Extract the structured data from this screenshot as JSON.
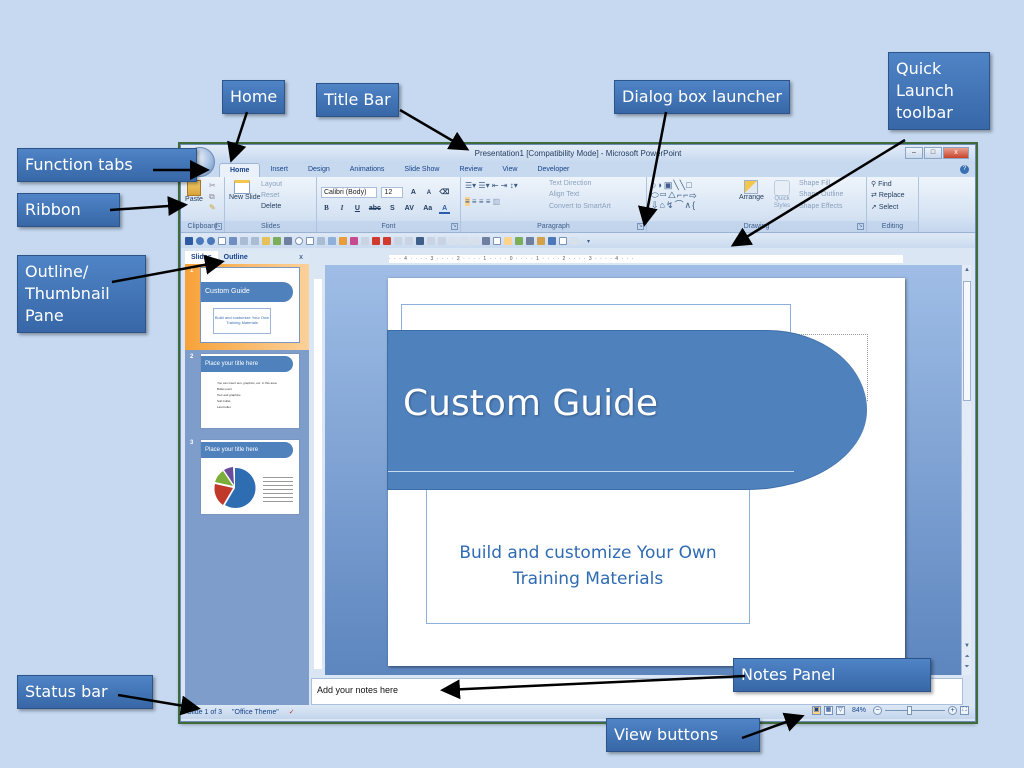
{
  "callouts": {
    "home": "Home",
    "title_bar": "Title Bar",
    "dialog_box_launcher": "Dialog box launcher",
    "quick_launch_toolbar": "Quick Launch toolbar",
    "function_tabs": "Function tabs",
    "ribbon": "Ribbon",
    "outline_thumbnail_pane": "Outline/ Thumbnail Pane",
    "status_bar": "Status bar",
    "notes_panel": "Notes Panel",
    "view_buttons": "View buttons"
  },
  "window": {
    "title": "Presentation1 [Compatibility Mode] - Microsoft PowerPoint",
    "controls": {
      "minimize": "–",
      "maximize": "□",
      "close": "x"
    }
  },
  "tabs": [
    "Home",
    "Insert",
    "Design",
    "Animations",
    "Slide Show",
    "Review",
    "View",
    "Developer"
  ],
  "active_tab": "Home",
  "ribbon": {
    "clipboard": {
      "paste": "Paste",
      "label": "Clipboard"
    },
    "slides": {
      "new_slide": "New Slide",
      "layout": "Layout",
      "reset": "Reset",
      "delete": "Delete",
      "label": "Slides"
    },
    "font": {
      "font_name": "Calibri (Body)",
      "font_size": "12",
      "bold": "B",
      "italic": "I",
      "underline": "U",
      "strike": "abc",
      "shadow": "S",
      "spacing": "AV",
      "case": "Aa",
      "color": "A",
      "grow": "A",
      "shrink": "A",
      "label": "Font"
    },
    "paragraph": {
      "text_direction": "Text Direction",
      "align_text": "Align Text",
      "convert_smartart": "Convert to SmartArt",
      "label": "Paragraph"
    },
    "drawing": {
      "arrange": "Arrange",
      "quick_styles": "Quick Styles",
      "shape_fill": "Shape Fill",
      "shape_outline": "Shape Outline",
      "shape_effects": "Shape Effects",
      "label": "Drawing"
    },
    "editing": {
      "find": "Find",
      "replace": "Replace",
      "select": "Select",
      "label": "Editing"
    }
  },
  "left_pane": {
    "tabs": [
      "Slides",
      "Outline"
    ],
    "active_tab": "Slides",
    "close": "x",
    "thumbnails": [
      {
        "num": "1",
        "title": "Custom Guide",
        "subtitle": "Build and customize Your Own Training Materials",
        "selected": true
      },
      {
        "num": "2",
        "title": "Place your title here",
        "bullets": [
          "You can insert text, graphics, etc. in this area",
          "Bullet point",
          "Text and graphics",
          "Sub bullet",
          "Last bullet"
        ]
      },
      {
        "num": "3",
        "title": "Place your title here",
        "has_chart": true
      }
    ]
  },
  "ruler": {
    "horizontal": "· · · 4 · · · · 3 · · · · 2 · · · · 1 · · · · 0 · · · · 1 · · · · 2 · · · · 3 · · · · 4 · · ·"
  },
  "slide": {
    "title": "Custom Guide",
    "subtitle": "Build and customize Your Own Training Materials",
    "banner_color": "#4f81bd"
  },
  "notes": {
    "text": "Add your notes here"
  },
  "status": {
    "slide_indicator": "Slide 1 of 3",
    "theme": "\"Office Theme\"",
    "zoom": "84%",
    "zoom_level_percent": 84
  },
  "colors": {
    "background": "#c6d9f0",
    "callout": "#3f75b8",
    "ribbon_text": "#15428b",
    "selected_thumb": "#f7a239"
  }
}
